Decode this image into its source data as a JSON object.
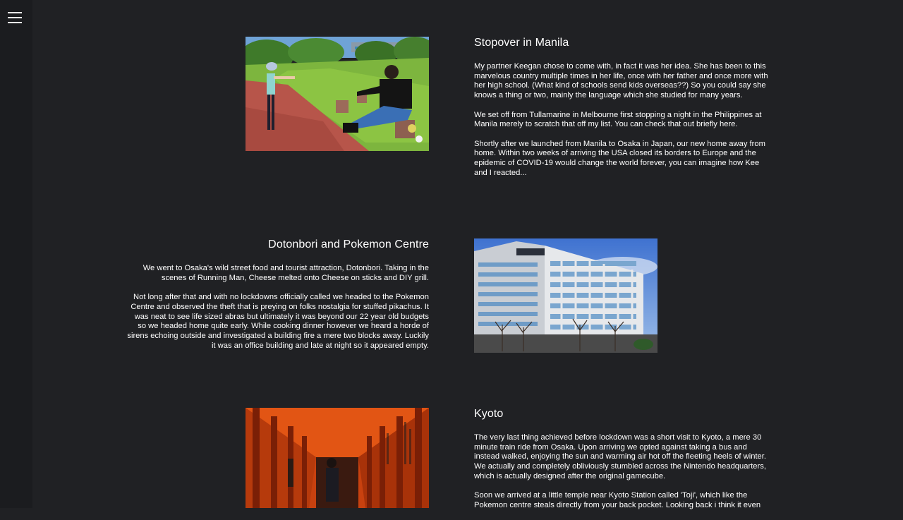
{
  "nav": {
    "menu_icon": "hamburger-menu-icon"
  },
  "posts": [
    {
      "title": "Stopover in Manila",
      "paragraphs": [
        "My partner Keegan chose to come with, in fact it was her idea. She has been to this marvelous country multiple times in her life, once with her father and once more with her high school. (What kind of schools send kids overseas??) So you could say she knows a thing or two, mainly the language which she studied for many years.",
        "We set off from Tullamarine in Melbourne first stopping a night in the Philippines at Manila merely to scratch that off my list. You can check that out briefly here.",
        "Shortly after we launched from Manila to Osaka in Japan, our new home away from home. Within two weeks of arriving the USA closed its borders to Europe and the epidemic of COVID-19 would change the world forever, you can imagine how Kee and I reacted..."
      ],
      "image": "park-photo"
    },
    {
      "title": "Dotonbori and Pokemon Centre",
      "paragraphs": [
        "We went to Osaka's wild street food and tourist attraction, Dotonbori. Taking in the scenes of Running Man, Cheese melted onto Cheese on sticks and DIY grill.",
        "Not long after that and with no lockdowns officially called we headed to the Pokemon Centre and observed the theft that is preying on folks nostalgia for stuffed pikachus. It was neat to see life sized abras but ultimately it was beyond our 22 year old budgets so we headed home quite early. While cooking dinner however we heard a horde of sirens echoing outside and investigated a building fire a mere two blocks away. Luckily it was an office building and late at night so it appeared empty."
      ],
      "image": "office-building-photo"
    },
    {
      "title": "Kyoto",
      "paragraphs": [
        "The very last thing achieved before lockdown was a short visit to Kyoto, a mere 30 minute train ride from Osaka. Upon arriving we opted against taking a bus and instead walked, enjoying the sun and warming air hot off the fleeting heels of winter. We actually and completely obliviously stumbled across the Nintendo headquarters, which is actually designed after the original gamecube.",
        "Soon we arrived at a little temple near Kyoto Station called 'Toji', which like the Pokemon centre steals directly from your back pocket. Looking back i think it even"
      ],
      "image": "torii-gates-photo"
    }
  ]
}
